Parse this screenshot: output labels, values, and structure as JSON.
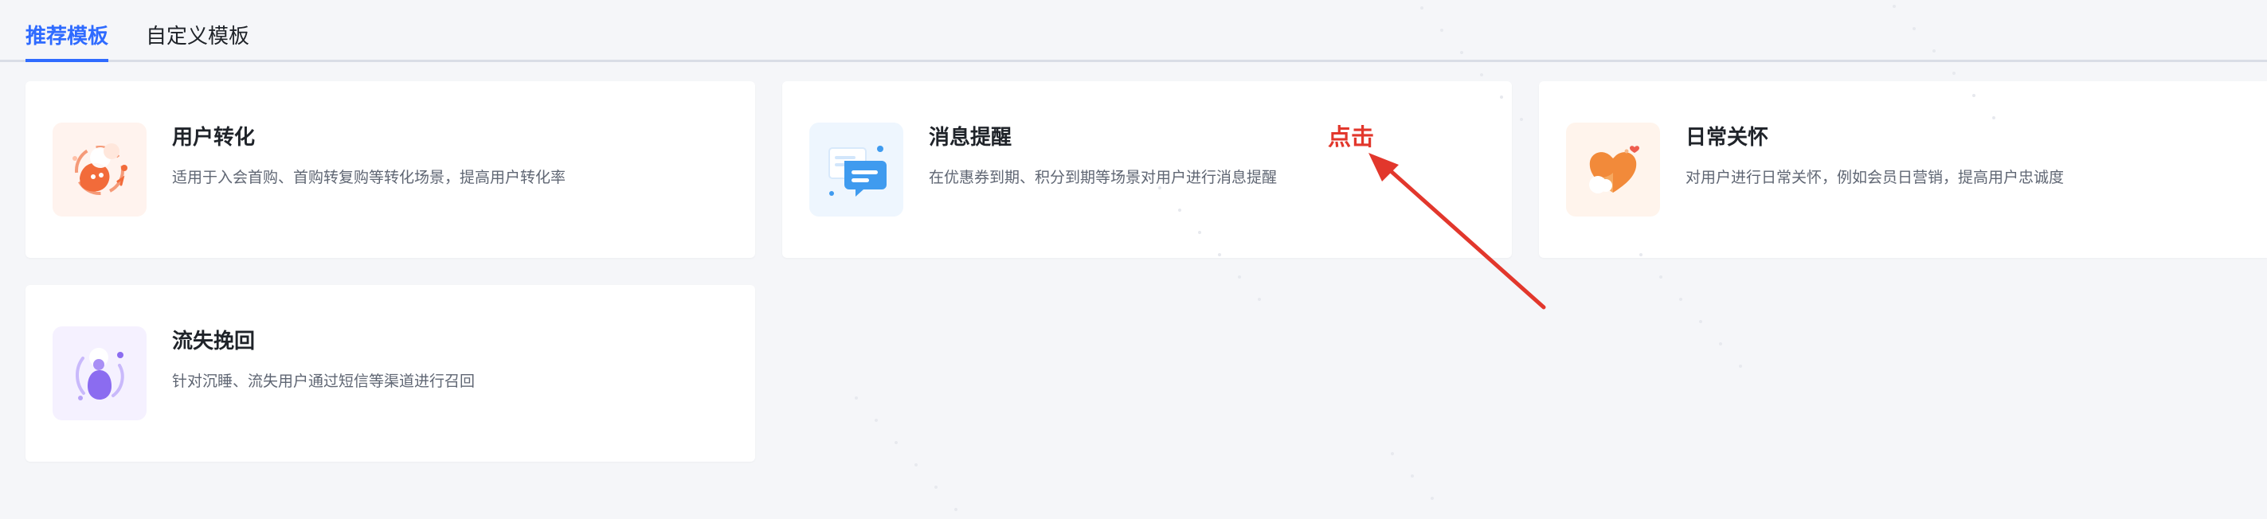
{
  "tabs": [
    {
      "label": "推荐模板",
      "active": true
    },
    {
      "label": "自定义模板",
      "active": false
    }
  ],
  "templates": [
    {
      "title": "用户转化",
      "description": "适用于入会首购、首购转复购等转化场景，提高用户转化率",
      "icon": "user-conversion-icon",
      "accent": "#f26b3a"
    },
    {
      "title": "消息提醒",
      "description": "在优惠券到期、积分到期等场景对用户进行消息提醒",
      "icon": "message-bubble-icon",
      "accent": "#3f9bef"
    },
    {
      "title": "日常关怀",
      "description": "对用户进行日常关怀，例如会员日营销，提高用户忠诚度",
      "icon": "heart-care-icon",
      "accent": "#f28a3a"
    },
    {
      "title": "流失挽回",
      "description": "针对沉睡、流失用户通过短信等渠道进行召回",
      "icon": "user-recall-icon",
      "accent": "#8b6cf0"
    }
  ],
  "annotation": {
    "label": "点击",
    "color": "#e2372c"
  },
  "colors": {
    "primary": "#2f6bff",
    "background": "#f5f6f9",
    "card": "#ffffff"
  }
}
